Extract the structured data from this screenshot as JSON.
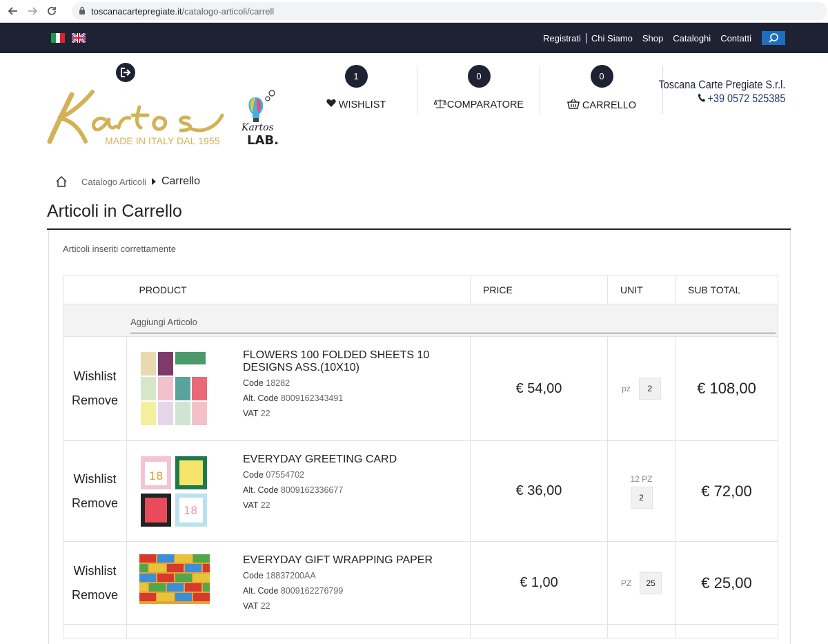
{
  "browser": {
    "url_host": "toscanacartepregiate.it",
    "url_path": "/catalogo-articoli/carrell"
  },
  "topnav": {
    "flags": [
      "italian-flag-icon",
      "uk-flag-icon"
    ],
    "links": [
      "Registrati",
      "Chi Siamo",
      "Shop",
      "Cataloghi",
      "Contatti"
    ]
  },
  "header": {
    "logo_tagline": "MADE IN ITALY DAL 1955",
    "wishlist": {
      "count": "1",
      "label": "WISHLIST"
    },
    "comparatore": {
      "count": "0",
      "label": "COMPARATORE"
    },
    "carrello": {
      "count": "0",
      "label": "CARRELLO"
    },
    "company_name": "Toscana Carte Pregiate S.r.l.",
    "company_phone": "+39 0572 525385"
  },
  "breadcrumb": {
    "parent": "Catalogo Articoli",
    "current": "Carrello"
  },
  "page_title": "Articoli in Carrello",
  "notice": "Articoli inseriti correttamente",
  "table": {
    "headers": {
      "product": "PRODUCT",
      "price": "PRICE",
      "unit": "UNIT",
      "subtotal": "SUB TOTAL"
    },
    "add_article": "Aggiungi Articolo",
    "wishlist_label": "Wishlist",
    "remove_label": "Remove",
    "code_label": "Code",
    "alt_code_label": "Alt. Code",
    "vat_label": "VAT",
    "rows": [
      {
        "name": "FLOWERS 100 FOLDED SHEETS 10 DESIGNS ASS.(10X10)",
        "code": "18282",
        "alt_code": "8009162343491",
        "vat": "22",
        "price": "€ 54,00",
        "uom": "pz",
        "qty": "2",
        "subtotal": "€ 108,00"
      },
      {
        "name": "EVERYDAY GREETING CARD",
        "code": "07554702",
        "alt_code": "8009162336677",
        "vat": "22",
        "price": "€ 36,00",
        "uom": "12 PZ",
        "qty": "2",
        "subtotal": "€ 72,00"
      },
      {
        "name": "EVERYDAY GIFT WRAPPING PAPER",
        "code": "18837200AA",
        "alt_code": "8009162276799",
        "vat": "22",
        "price": "€ 1,00",
        "uom": "PZ",
        "qty": "25",
        "subtotal": "€ 25,00"
      }
    ]
  }
}
